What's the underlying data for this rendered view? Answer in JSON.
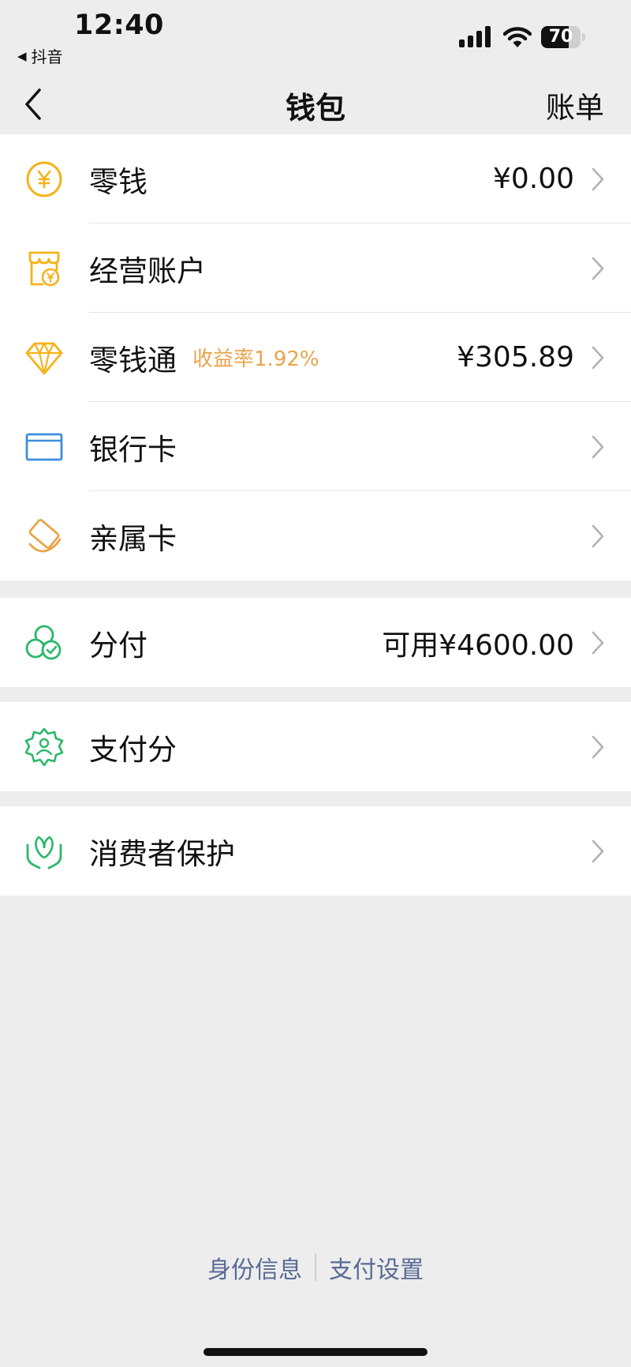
{
  "status_bar": {
    "time": "12:40",
    "back_app": "抖音",
    "battery_level": "70",
    "battery_fraction": 0.7
  },
  "nav": {
    "title": "钱包",
    "right_action": "账单"
  },
  "groups": [
    {
      "items": [
        {
          "key": "change",
          "label": "零钱",
          "value": "¥0.00",
          "icon": "yuan-coin-icon",
          "color": "#f5b21a"
        },
        {
          "key": "business-account",
          "label": "经营账户",
          "value": "",
          "icon": "shop-icon",
          "color": "#f5b21a"
        },
        {
          "key": "lingqiantong",
          "label": "零钱通",
          "badge": "收益率1.92%",
          "value": "¥305.89",
          "icon": "diamond-icon",
          "color": "#f5b21a"
        },
        {
          "key": "bank-card",
          "label": "银行卡",
          "value": "",
          "icon": "bank-card-icon",
          "color": "#3d8fe0"
        },
        {
          "key": "family-card",
          "label": "亲属卡",
          "value": "",
          "icon": "family-card-icon",
          "color": "#e8a54a"
        }
      ]
    },
    {
      "items": [
        {
          "key": "fenfu",
          "label": "分付",
          "value": "可用¥4600.00",
          "icon": "fenfu-icon",
          "color": "#2bb86a"
        }
      ]
    },
    {
      "items": [
        {
          "key": "pay-score",
          "label": "支付分",
          "value": "",
          "icon": "pay-score-icon",
          "color": "#2bb86a"
        }
      ]
    },
    {
      "items": [
        {
          "key": "consumer-protection",
          "label": "消费者保护",
          "value": "",
          "icon": "protection-hands-icon",
          "color": "#2bb86a"
        }
      ]
    }
  ],
  "footer": {
    "identity": "身份信息",
    "pay_settings": "支付设置"
  },
  "colors": {
    "page_bg": "#ededed",
    "link": "#586b95",
    "badge": "#e8a54a"
  }
}
